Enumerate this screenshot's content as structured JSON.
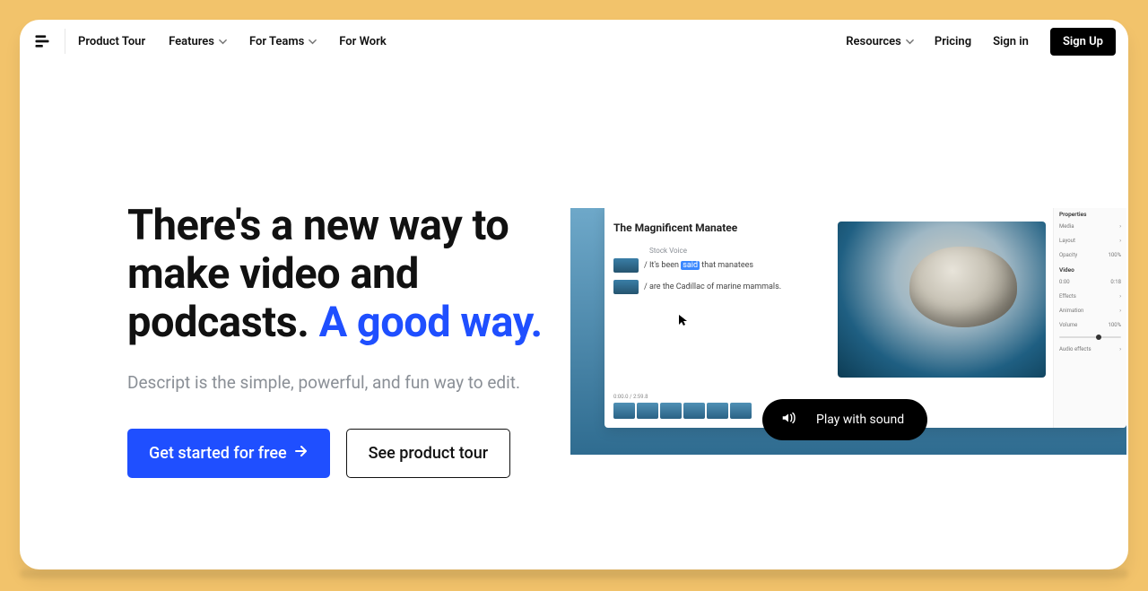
{
  "nav": {
    "items": [
      "Product Tour",
      "Features",
      "For Teams",
      "For Work"
    ],
    "right": [
      "Resources",
      "Pricing",
      "Sign in"
    ],
    "signup": "Sign Up"
  },
  "hero": {
    "title_plain": "There's a new way to make video and podcasts. ",
    "title_accent": "A good way.",
    "subtitle": "Descript is the simple, powerful, and fun way to edit.",
    "cta_primary": "Get started for free",
    "cta_secondary": "See product tour"
  },
  "video": {
    "play_label": "Play with sound",
    "doc_title": "The Magnificent Manatee",
    "voice_label": "Stock Voice",
    "line1_pre": "/ It's been ",
    "line1_hl": "said",
    "line1_post": " that manatees",
    "line2": "/ are the Cadillac of marine mammals.",
    "timecode": "0:00.0 / 2:59.8",
    "props": {
      "header": "Properties",
      "media": "Media",
      "layout": "Layout",
      "opacity_label": "Opacity",
      "opacity_value": "100%",
      "video_label": "Video",
      "start": "0:00",
      "end": "0:18",
      "effects": "Effects",
      "animation": "Animation",
      "volume_label": "Volume",
      "volume_value": "100%",
      "audio_effects": "Audio effects"
    }
  }
}
